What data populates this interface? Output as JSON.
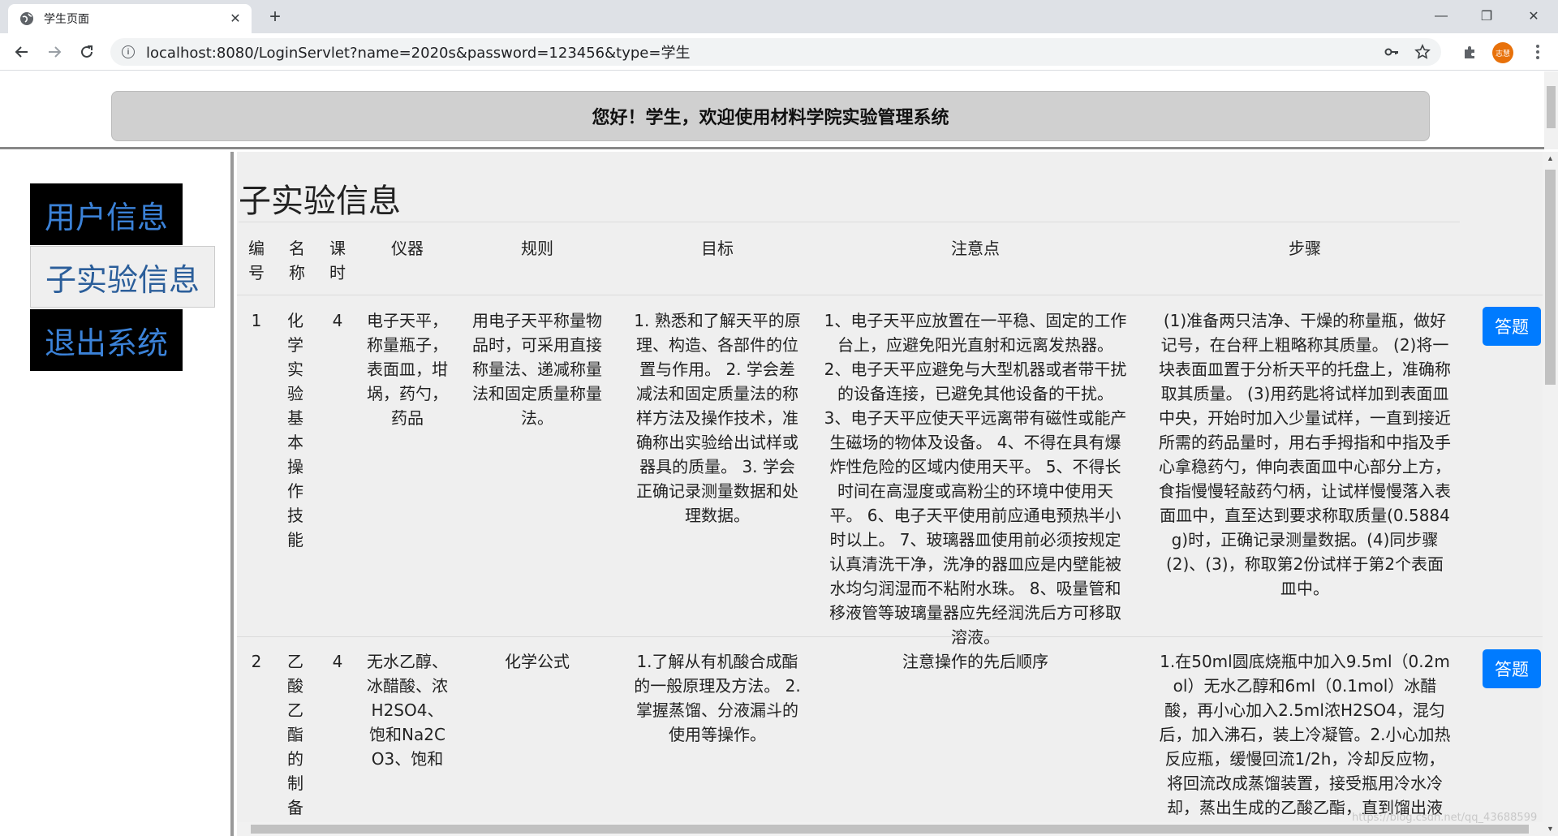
{
  "browser": {
    "tab_title": "学生页面",
    "tab_close": "✕",
    "new_tab": "+",
    "url": "localhost:8080/LoginServlet?name=2020s&password=123456&type=学生",
    "info_icon": "i",
    "avatar_text": "志慧"
  },
  "window_controls": {
    "minimize": "—",
    "restore": "❐",
    "close": "✕"
  },
  "banner": {
    "text": "您好！学生，欢迎使用材料学院实验管理系统"
  },
  "sidebar": {
    "items": [
      {
        "label": "用户信息"
      },
      {
        "label": "子实验信息"
      },
      {
        "label": "退出系统"
      }
    ]
  },
  "main": {
    "title": "子实验信息",
    "headers": {
      "id": "编号",
      "name": "名称",
      "hours": "课时",
      "instruments": "仪器",
      "rules": "规则",
      "goals": "目标",
      "notes": "注意点",
      "steps": "步骤"
    },
    "rows": [
      {
        "id": "1",
        "name": "化学实验基本操作技能",
        "hours": "4",
        "instruments": "电子天平，称量瓶子，表面皿，坩埚，药勺，药品",
        "rules": "用电子天平称量物品时，可采用直接称量法、递减称量法和固定质量称量法。",
        "goals": "1. 熟悉和了解天平的原理、构造、各部件的位置与作用。 2. 学会差减法和固定质量法的称样方法及操作技术，准确称出实验给出试样或器具的质量。 3. 学会正确记录测量数据和处理数据。",
        "notes": "1、电子天平应放置在一平稳、固定的工作台上，应避免阳光直射和远离发热器。 2、电子天平应避免与大型机器或者带干扰的设备连接，已避免其他设备的干扰。 3、电子天平应使天平远离带有磁性或能产生磁场的物体及设备。 4、不得在具有爆炸性危险的区域内使用天平。 5、不得长时间在高湿度或高粉尘的环境中使用天平。 6、电子天平使用前应通电预热半小时以上。 7、玻璃器皿使用前必须按规定认真清洗干净，洗净的器皿应是内壁能被水均匀润湿而不粘附水珠。 8、吸量管和移液管等玻璃量器应先经润洗后方可移取溶液。",
        "steps": "(1)准备两只洁净、干燥的称量瓶，做好记号，在台秤上粗略称其质量。 (2)将一块表面皿置于分析天平的托盘上，准确称取其质量。 (3)用药匙将试样加到表面皿中央，开始时加入少量试样，一直到接近所需的药品量时，用右手拇指和中指及手心拿稳药勺，伸向表面皿中心部分上方，食指慢慢轻敲药勺柄，让试样慢慢落入表面皿中，直至达到要求称取质量(0.5884g)时，正确记录测量数据。(4)同步骤(2)、(3)，称取第2份试样于第2个表面皿中。",
        "button": "答题"
      },
      {
        "id": "2",
        "name": "乙酸乙酯的制备",
        "hours": "4",
        "instruments": "无水乙醇、冰醋酸、浓H2SO4、饱和Na2CO3、饱和",
        "rules": "化学公式",
        "goals": "1.了解从有机酸合成酯的一般原理及方法。 2.掌握蒸馏、分液漏斗的使用等操作。",
        "notes": "注意操作的先后顺序",
        "steps": "1.在50ml圆底烧瓶中加入9.5ml（0.2mol）无水乙醇和6ml（0.1mol）冰醋酸，再小心加入2.5ml浓H2SO4，混匀后，加入沸石，装上冷凝管。2.小心加热反应瓶，缓慢回流1/2h，冷却反应物，将回流改成蒸馏装置，接受瓶用冷水冷却，蒸出生成的乙酸乙酯，直到馏出液",
        "button": "答题"
      }
    ]
  },
  "watermark": "https://blog.csdn.net/qq_43688599"
}
